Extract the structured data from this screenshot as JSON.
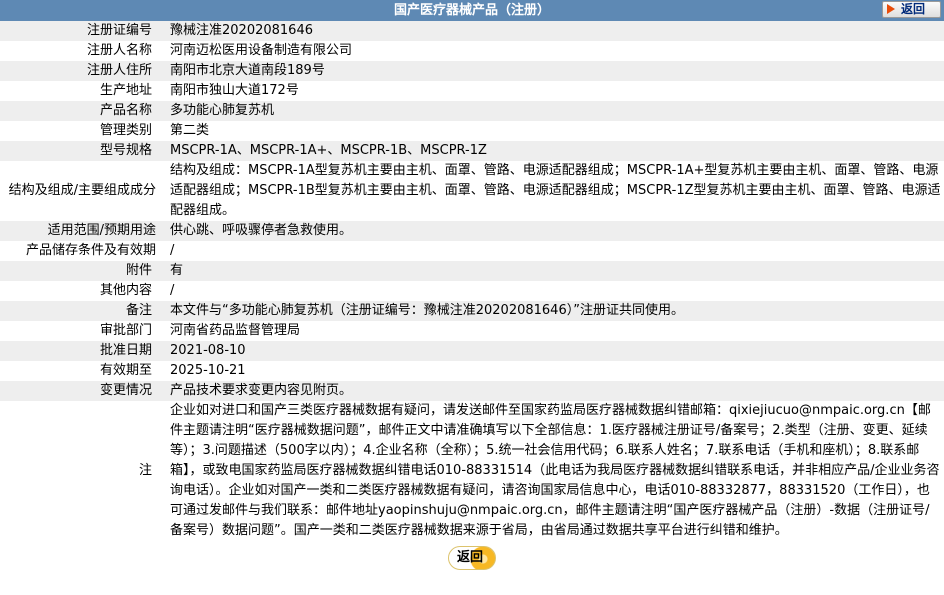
{
  "header": {
    "title": "国产医疗器械产品（注册）",
    "back_label": "返回"
  },
  "rows": [
    {
      "label": "注册证编号",
      "value": "豫械注准20202081646"
    },
    {
      "label": "注册人名称",
      "value": "河南迈松医用设备制造有限公司"
    },
    {
      "label": "注册人住所",
      "value": "南阳市北京大道南段189号"
    },
    {
      "label": "生产地址",
      "value": "南阳市独山大道172号"
    },
    {
      "label": "产品名称",
      "value": "多功能心肺复苏机"
    },
    {
      "label": "管理类别",
      "value": "第二类"
    },
    {
      "label": "型号规格",
      "value": "MSCPR-1A、MSCPR-1A+、MSCPR-1B、MSCPR-1Z"
    },
    {
      "label": "结构及组成/主要组成成分",
      "value": "结构及组成：MSCPR-1A型复苏机主要由主机、面罩、管路、电源适配器组成；MSCPR-1A+型复苏机主要由主机、面罩、管路、电源适配器组成；MSCPR-1B型复苏机主要由主机、面罩、管路、电源适配器组成；MSCPR-1Z型复苏机主要由主机、面罩、管路、电源适配器组成。"
    },
    {
      "label": "适用范围/预期用途",
      "value": "供心跳、呼吸骤停者急救使用。"
    },
    {
      "label": "产品储存条件及有效期",
      "value": "/"
    },
    {
      "label": "附件",
      "value": "有"
    },
    {
      "label": "其他内容",
      "value": "/"
    },
    {
      "label": "备注",
      "value": "本文件与“多功能心肺复苏机（注册证编号：豫械注准20202081646）”注册证共同使用。"
    },
    {
      "label": "审批部门",
      "value": "河南省药品监督管理局"
    },
    {
      "label": "批准日期",
      "value": "2021-08-10"
    },
    {
      "label": "有效期至",
      "value": "2025-10-21"
    },
    {
      "label": "变更情况",
      "value": "产品技术要求变更内容见附页。"
    }
  ],
  "note": {
    "label": "注",
    "text": "企业如对进口和国产三类医疗器械数据有疑问，请发送邮件至国家药监局医疗器械数据纠错邮箱：qixiejiucuo@nmpaic.org.cn【邮件主题请注明“医疗器械数据问题”，邮件正文中请准确填写以下全部信息：1.医疗器械注册证号/备案号；2.类型（注册、变更、延续等）；3.问题描述（500字以内）；4.企业名称（全称）；5.统一社会信用代码；6.联系人姓名；7.联系电话（手机和座机）；8.联系邮箱】，或致电国家药监局医疗器械数据纠错电话010-88331514（此电话为我局医疗器械数据纠错联系电话，并非相应产品/企业业务咨询电话）。企业如对国产一类和二类医疗器械数据有疑问，请咨询国家局信息中心，电话010-88332877，88331520（工作日），也可通过发邮件与我们联系：邮件地址yaopinshuju@nmpaic.org.cn，邮件主题请注明“国产医疗器械产品（注册）-数据（注册证号/备案号）数据问题”。国产一类和二类医疗器械数据来源于省局，由省局通过数据共享平台进行纠错和维护。"
  },
  "footer": {
    "back_label": "返回"
  }
}
